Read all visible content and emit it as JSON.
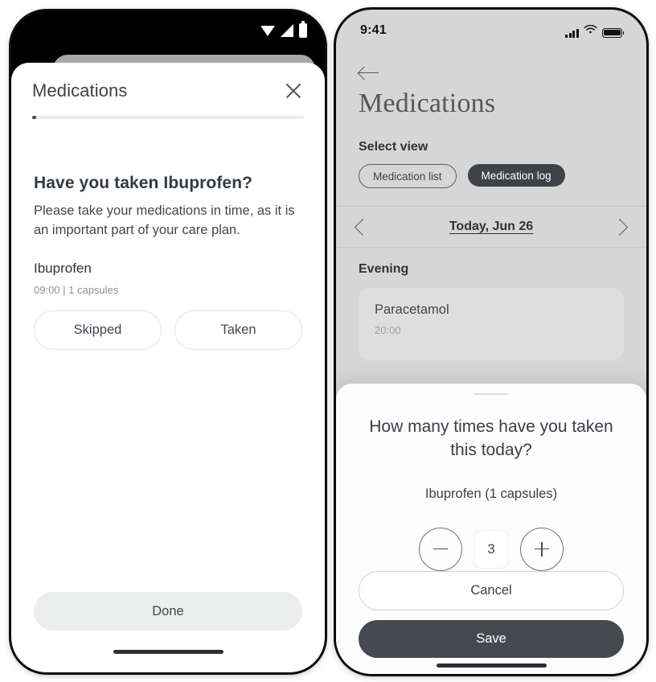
{
  "left_phone": {
    "platform": "android",
    "status_bar": {
      "icons": [
        "wifi-icon",
        "signal-icon",
        "battery-icon"
      ]
    },
    "sheet": {
      "title": "Medications",
      "close_icon": "close-icon",
      "progress_percent": 2,
      "question": "Have you taken Ibuprofen?",
      "subtitle": "Please take your medications in time, as it is an important part of your care plan.",
      "medication_name": "Ibuprofen",
      "medication_meta": "09:00 | 1 capsules",
      "choices": [
        {
          "label": "Skipped"
        },
        {
          "label": "Taken"
        }
      ],
      "primary_action": "Done"
    }
  },
  "right_phone": {
    "platform": "ios",
    "status_bar": {
      "time": "9:41",
      "icons": [
        "cellular-icon",
        "wifi-icon",
        "battery-icon"
      ]
    },
    "header": {
      "back_icon": "back-arrow-icon",
      "title": "Medications"
    },
    "select_view": {
      "label": "Select view",
      "options": [
        {
          "label": "Medication list",
          "selected": false
        },
        {
          "label": "Medication log",
          "selected": true
        }
      ]
    },
    "date_nav": {
      "prev_icon": "chevron-left-icon",
      "label": "Today, Jun 26",
      "next_icon": "chevron-right-icon"
    },
    "section": {
      "label": "Evening",
      "cards": [
        {
          "name": "Paracetamol",
          "meta": "20:00"
        }
      ]
    },
    "bottom_sheet": {
      "grabber": "drag-handle",
      "question": "How many times have you taken this today?",
      "medication": "Ibuprofen (1 capsules)",
      "stepper": {
        "decrement_icon": "minus-icon",
        "value": "3",
        "increment_icon": "plus-icon"
      },
      "cancel_label": "Cancel",
      "save_label": "Save"
    }
  },
  "colors": {
    "accent_dark": "#46494d",
    "screen_bg": "#d6d6d6",
    "card_bg": "#dedede",
    "sheet_bg": "#fdfdfd"
  }
}
